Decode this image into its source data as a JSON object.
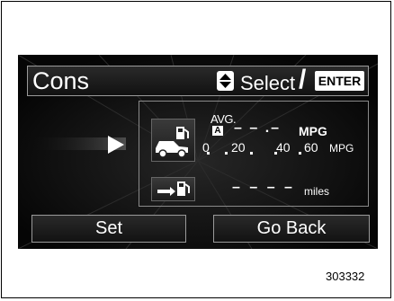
{
  "header": {
    "title": "Cons",
    "select_label": "Select",
    "separator": "/",
    "enter_label": "ENTER",
    "updown_icon": "up-down-arrows-icon"
  },
  "consumption": {
    "avg_label": "AVG.",
    "avg_badge": "A",
    "avg_value": "– – .–",
    "avg_unit": "MPG",
    "icon": "car-fuel-pump-icon",
    "scale_ticks": [
      "0",
      "20",
      "40",
      "60"
    ],
    "scale_unit": "MPG"
  },
  "range": {
    "icon": "arrow-fuel-pump-icon",
    "value": "– – – –",
    "unit": "miles"
  },
  "buttons": {
    "set": "Set",
    "go_back": "Go Back"
  },
  "figure_number": "303332",
  "colors": {
    "screen_bg": "#070707",
    "text": "#ffffff",
    "border": "#9a9a9a"
  }
}
